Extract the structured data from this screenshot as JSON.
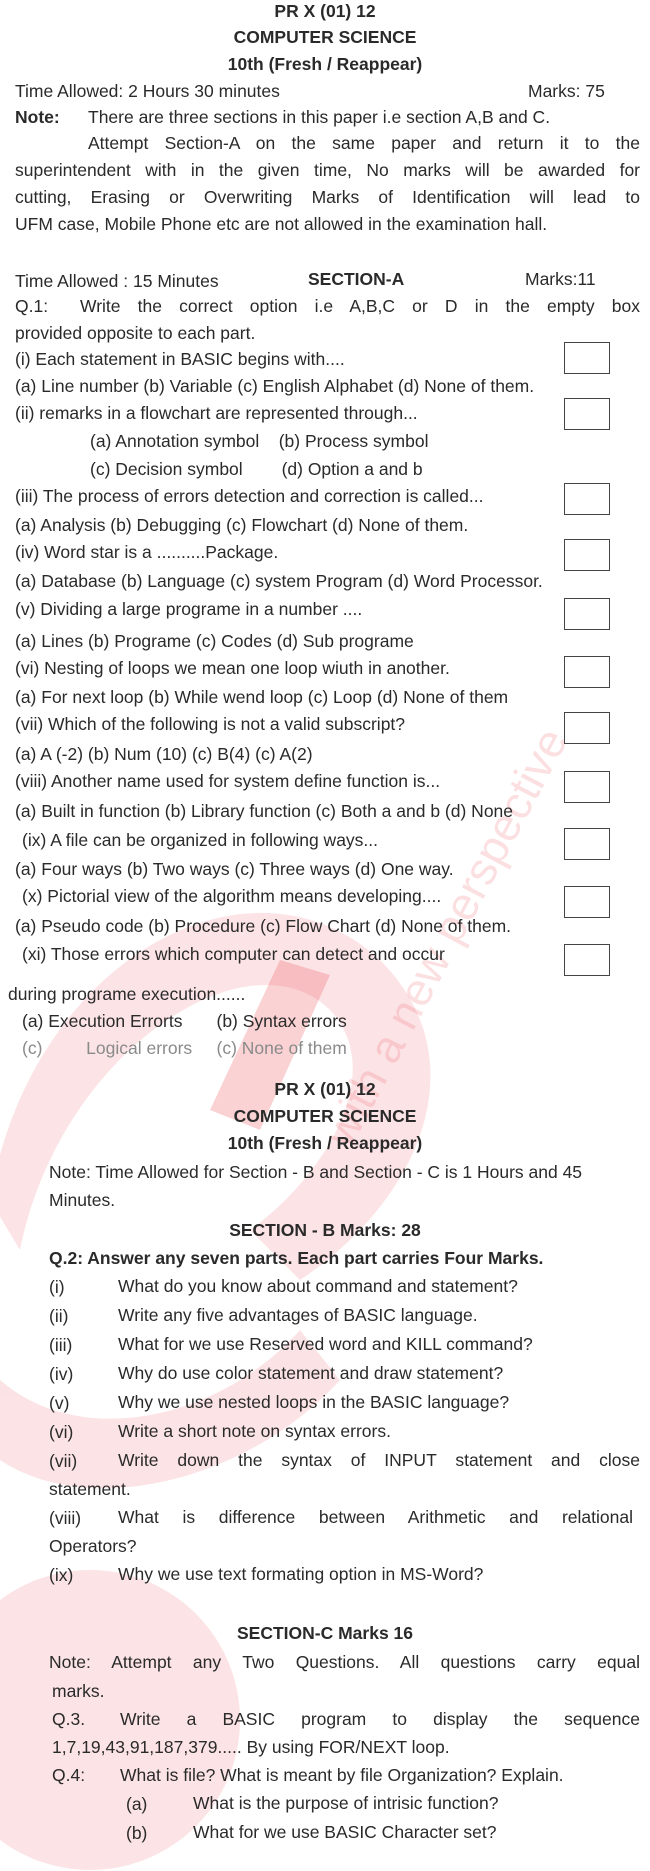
{
  "part1": {
    "paper_code": "PR X (01) 12",
    "subject": "COMPUTER SCIENCE",
    "class": "10th (Fresh / Reappear)",
    "time_allowed": "Time Allowed: 2 Hours 30 minutes",
    "total_marks": "Marks: 75",
    "note_label": "Note:",
    "note_line1": "There are three sections in this paper i.e section A,B and C.",
    "note_line2": "Attempt Section-A on the same paper and return it to the",
    "note_line3": "superintendent with in the given time, No marks will be awarded for",
    "note_line4": "cutting, Erasing or Overwriting  Marks of Identification will lead to",
    "note_line5": "UFM case, Mobile Phone etc are not allowed in the examination hall."
  },
  "section_a": {
    "time": "Time Allowed : 15 Minutes",
    "title": "SECTION-A",
    "marks": "Marks:11",
    "q1_label": "Q.1:",
    "q1_line1": "Write the correct option i.e A,B,C or D in the empty box",
    "q1_line2": "provided opposite to each part.",
    "mcqs": [
      {
        "q": "(i) Each statement in BASIC begins with....",
        "opts": [
          "(a) Line number (b) Variable (c) English Alphabet (d) None of them."
        ]
      },
      {
        "q": "(ii) remarks in a flowchart are represented through...",
        "opts": [
          "(a) Annotation symbol    (b) Process symbol",
          "(c) Decision symbol        (d) Option a and b"
        ]
      },
      {
        "q": "(iii) The process of errors detection and correction is called...",
        "opts": [
          "(a) Analysis (b) Debugging (c) Flowchart (d) None of them."
        ]
      },
      {
        "q": "(iv) Word star is a ..........Package.",
        "opts": [
          "(a) Database (b) Language (c) system Program (d) Word Processor."
        ]
      },
      {
        "q": "(v) Dividing a large programe in a number ....",
        "opts": [
          "(a) Lines (b) Programe (c) Codes (d) Sub programe"
        ]
      },
      {
        "q": "(vi) Nesting of loops we mean one loop wiuth in another.",
        "opts": [
          "(a) For next loop (b) While wend loop (c) Loop (d) None of them"
        ]
      },
      {
        "q": "(vii) Which of the following is not a valid subscript?",
        "opts": [
          "(a) A (-2) (b) Num (10) (c) B(4) (c) A(2)"
        ]
      },
      {
        "q": "(viii) Another name used for system define function is...",
        "opts": [
          "(a) Built in function (b) Library function (c) Both a and b (d) None"
        ]
      },
      {
        "q": "(ix) A file can be organized in following ways...",
        "opts": [
          "(a) Four ways (b) Two ways (c) Three ways (d) One way."
        ]
      },
      {
        "q": "(x) Pictorial view of the algorithm means developing....",
        "opts": [
          "(a) Pseudo code (b) Procedure (c) Flow Chart (d) None of them."
        ]
      },
      {
        "q": "(xi) Those errors which computer can detect and occur",
        "q2": "during programe execution......",
        "opts": [
          "(a) Execution Errorts       (b) Syntax errors",
          "(c)         Logical errors     (c) None of them"
        ]
      }
    ]
  },
  "part2": {
    "paper_code": "PR X (01) 12",
    "subject": "COMPUTER SCIENCE",
    "class": "10th (Fresh / Reappear)",
    "note_line1": "Note: Time Allowed for Section - B and Section - C is 1 Hours and 45",
    "note_line2": "Minutes."
  },
  "section_b": {
    "title": "SECTION - B    Marks: 28",
    "instruction": "Q.2: Answer any seven parts. Each part carries Four Marks.",
    "items": [
      {
        "num": "(i)",
        "text": "What do you know about command and statement?"
      },
      {
        "num": "(ii)",
        "text": "Write any five advantages of BASIC language."
      },
      {
        "num": "(iii)",
        "text": "What for we use Reserved word and KILL command?"
      },
      {
        "num": "(iv)",
        "text": "Why do use color statement and draw statement?"
      },
      {
        "num": "(v)",
        "text": "Why we use nested loops in the BASIC language?"
      },
      {
        "num": "(vi)",
        "text": "Write a short note on syntax errors."
      },
      {
        "num": "(vii)",
        "text": "Write down the syntax of INPUT statement and close",
        "cont": "statement."
      },
      {
        "num": "(viii)",
        "text": "What is difference between Arithmetic and relational",
        "cont": "Operators?"
      },
      {
        "num": "(ix)",
        "text": "Why we use text formating option in MS-Word?"
      }
    ]
  },
  "section_c": {
    "title": "SECTION-C Marks 16",
    "note_line1": "Note: Attempt any Two Questions. All questions carry equal",
    "note_line2": "marks.",
    "q3_label": "Q.3.",
    "q3_line1": "Write a BASIC program to display the sequence",
    "q3_line2": "1,7,19,43,91,187,379..... By using FOR/NEXT loop.",
    "q4_label": "Q.4:",
    "q4_text": "What is file? What is meant by file Organization? Explain.",
    "q4_parts": [
      {
        "num": "(a)",
        "text": "What is the purpose of intrisic function?"
      },
      {
        "num": "(b)",
        "text": "What for we use BASIC Character set?"
      }
    ]
  },
  "watermark": {
    "text": "with a new perspective",
    "color": "#e8323c"
  }
}
